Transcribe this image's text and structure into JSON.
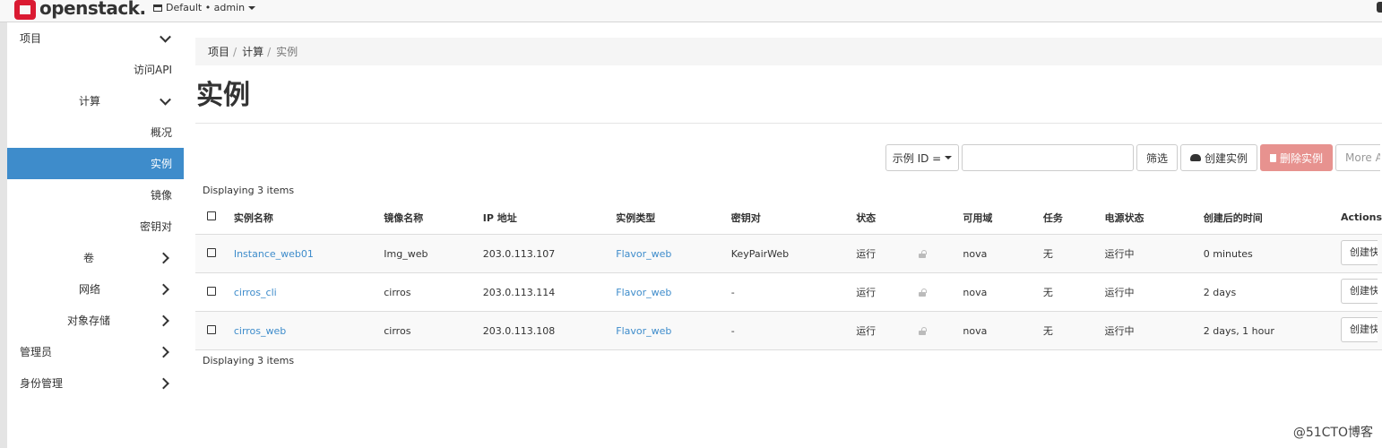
{
  "brand": {
    "name": "openstack."
  },
  "header": {
    "project_selector": "Default • admin"
  },
  "sidebar": {
    "items": [
      {
        "label": "项目"
      },
      {
        "label": "访问API"
      },
      {
        "label": "计算"
      },
      {
        "label": "概况"
      },
      {
        "label": "实例"
      },
      {
        "label": "镜像"
      },
      {
        "label": "密钥对"
      },
      {
        "label": "卷"
      },
      {
        "label": "网络"
      },
      {
        "label": "对象存储"
      },
      {
        "label": "管理员"
      },
      {
        "label": "身份管理"
      }
    ]
  },
  "breadcrumb": {
    "items": [
      "项目",
      "计算",
      "实例"
    ],
    "sep": "/"
  },
  "page": {
    "title": "实例"
  },
  "toolbar": {
    "filter_type": "示例 ID =",
    "filter_value": "",
    "filter_button": "筛选",
    "create_button": "创建实例",
    "delete_button": "删除实例",
    "more_button": "More Actions"
  },
  "table": {
    "display_count": "Displaying 3 items",
    "columns": [
      "实例名称",
      "镜像名称",
      "IP 地址",
      "实例类型",
      "密钥对",
      "状态",
      "",
      "可用域",
      "任务",
      "电源状态",
      "创建后的时间",
      "Actions"
    ],
    "rows": [
      {
        "name": "Instance_web01",
        "image": "Img_web",
        "ip": "203.0.113.107",
        "flavor": "Flavor_web",
        "keypair": "KeyPairWeb",
        "status": "运行",
        "zone": "nova",
        "task": "无",
        "power": "运行中",
        "age": "0 minutes",
        "action": "创建快照"
      },
      {
        "name": "cirros_cli",
        "image": "cirros",
        "ip": "203.0.113.114",
        "flavor": "Flavor_web",
        "keypair": "-",
        "status": "运行",
        "zone": "nova",
        "task": "无",
        "power": "运行中",
        "age": "2 days",
        "action": "创建快照"
      },
      {
        "name": "cirros_web",
        "image": "cirros",
        "ip": "203.0.113.108",
        "flavor": "Flavor_web",
        "keypair": "-",
        "status": "运行",
        "zone": "nova",
        "task": "无",
        "power": "运行中",
        "age": "2 days, 1 hour",
        "action": "创建快照"
      }
    ]
  },
  "watermark": "@51CTO博客",
  "colors": {
    "accent": "#3e8ccb",
    "danger": "#e7928f",
    "brand": "#da1a32"
  }
}
